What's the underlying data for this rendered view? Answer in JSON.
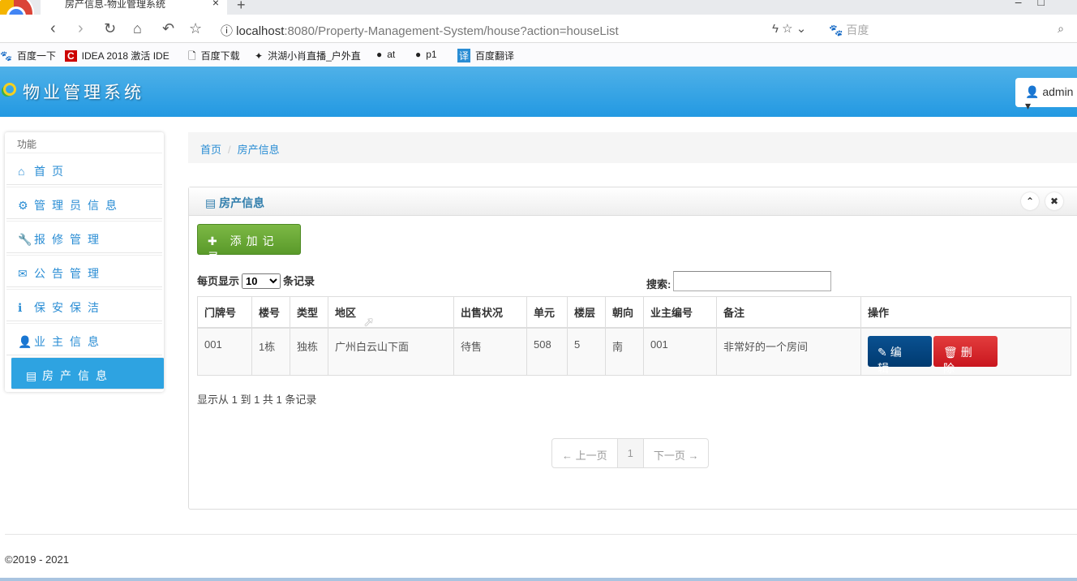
{
  "browser": {
    "tab_title": "房产信息-物业管理系统",
    "url_host": "localhost",
    "url_rest": ":8080/Property-Management-System/house?action=houseList",
    "search_placeholder": "百度",
    "bookmarks": [
      "百度一下",
      "IDEA 2018 激活 IDE",
      "百度下载",
      "洪湖小肖直播_户外直",
      "at",
      "p1",
      "百度翻译"
    ]
  },
  "header": {
    "brand": "物业管理系统",
    "user": "admin"
  },
  "sidebar": {
    "title": "功能",
    "items": [
      {
        "label": "首页",
        "icon": "home-icon"
      },
      {
        "label": "管理员信息",
        "icon": "gear-icon"
      },
      {
        "label": "报修管理",
        "icon": "wrench-icon"
      },
      {
        "label": "公告管理",
        "icon": "envelope-icon"
      },
      {
        "label": "保安保洁",
        "icon": "info-icon"
      },
      {
        "label": "业主信息",
        "icon": "user-icon"
      },
      {
        "label": "房产信息",
        "icon": "list-icon"
      }
    ]
  },
  "breadcrumb": [
    "首页",
    "房产信息"
  ],
  "panel": {
    "title": "房产信息",
    "add_label": "添加记录",
    "length_prefix": "每页显示",
    "length_value": "10",
    "length_suffix": "条记录",
    "search_label": "搜索:",
    "search_value": "",
    "columns": [
      "门牌号",
      "楼号",
      "类型",
      "地区",
      "出售状况",
      "单元",
      "楼层",
      "朝向",
      "业主编号",
      "备注",
      "操作"
    ],
    "rows": [
      [
        "001",
        "1栋",
        "独栋",
        "广州白云山下面",
        "待售",
        "508",
        "5",
        "南",
        "001",
        "非常好的一个房间"
      ]
    ],
    "edit_label": "编 辑",
    "delete_label": "删 除",
    "info": "显示从 1 到 1 共 1 条记录",
    "pager": {
      "prev": "← 上一页",
      "current": "1",
      "next": "下一页 →"
    }
  },
  "footer": "©2019 - 2021"
}
